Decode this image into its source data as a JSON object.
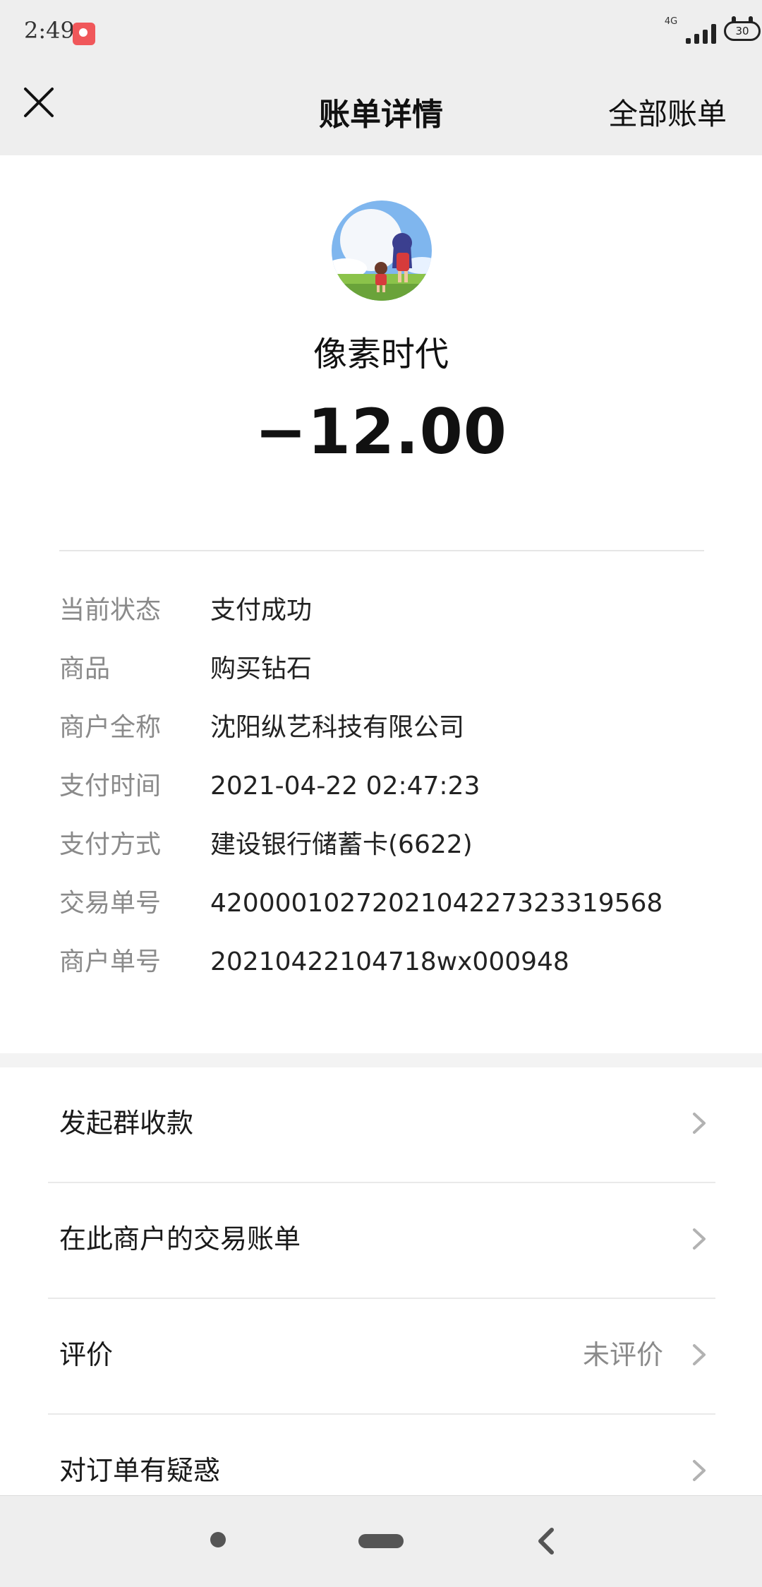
{
  "status_bar": {
    "time": "2:49",
    "network_type": "4G",
    "battery_level": "30"
  },
  "nav": {
    "title": "账单详情",
    "right_action": "全部账单"
  },
  "merchant": {
    "name": "像素时代",
    "amount": "−12.00"
  },
  "details": [
    {
      "label": "当前状态",
      "value": "支付成功"
    },
    {
      "label": "商品",
      "value": "购买钻石"
    },
    {
      "label": "商户全称",
      "value": "沈阳纵艺科技有限公司"
    },
    {
      "label": "支付时间",
      "value": "2021-04-22 02:47:23"
    },
    {
      "label": "支付方式",
      "value": "建设银行储蓄卡(6622)"
    },
    {
      "label": "交易单号",
      "value": "4200001027202104227323319568"
    },
    {
      "label": "商户单号",
      "value": "20210422104718wx000948"
    }
  ],
  "actions": [
    {
      "label": "发起群收款",
      "right": ""
    },
    {
      "label": "在此商户的交易账单",
      "right": ""
    },
    {
      "label": "评价",
      "right": "未评价"
    },
    {
      "label": "对订单有疑惑",
      "right": ""
    }
  ],
  "colors": {
    "header_bg": "#eeeeee",
    "label_gray": "#8a8a8a",
    "text_dark": "#1a1a1a"
  }
}
